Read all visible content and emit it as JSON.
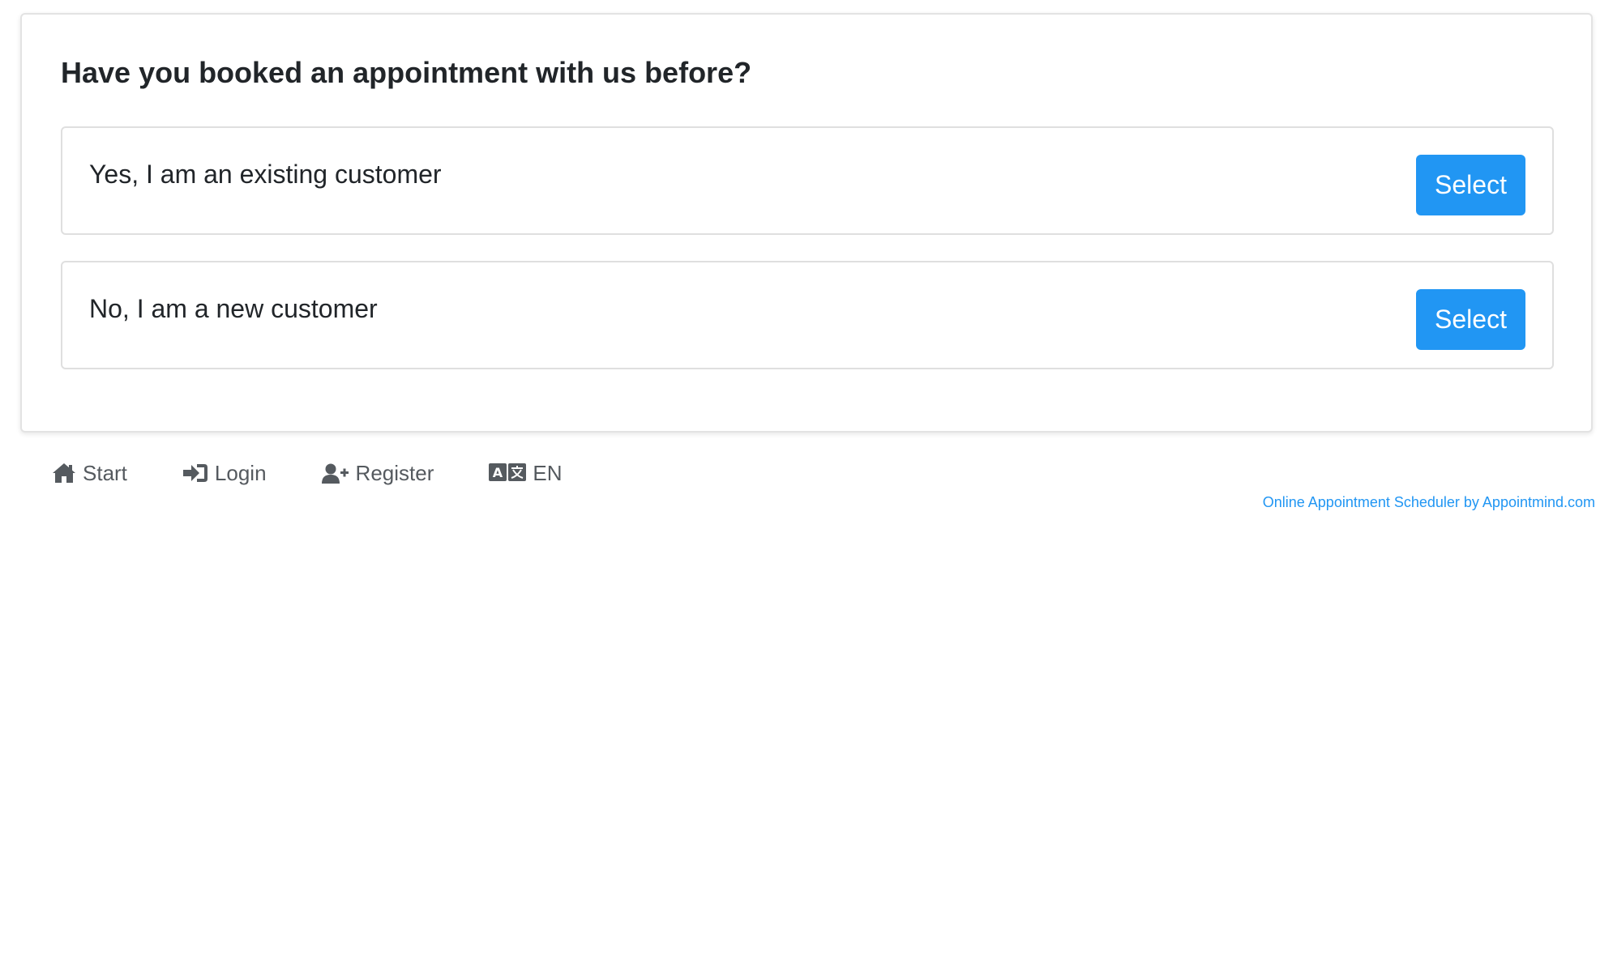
{
  "question": "Have you booked an appointment with us before?",
  "options": [
    {
      "label": "Yes, I am an existing customer",
      "button": "Select"
    },
    {
      "label": "No, I am a new customer",
      "button": "Select"
    }
  ],
  "nav": {
    "start": {
      "label": "Start",
      "icon": "home-icon"
    },
    "login": {
      "label": "Login",
      "icon": "sign-in-icon"
    },
    "register": {
      "label": "Register",
      "icon": "user-plus-icon"
    },
    "language": {
      "label": "EN",
      "icon": "language-icon"
    }
  },
  "credit": "Online Appointment Scheduler by Appointmind.com",
  "colors": {
    "accent": "#2196f3",
    "nav_text": "#555a5f",
    "heading": "#212529"
  }
}
